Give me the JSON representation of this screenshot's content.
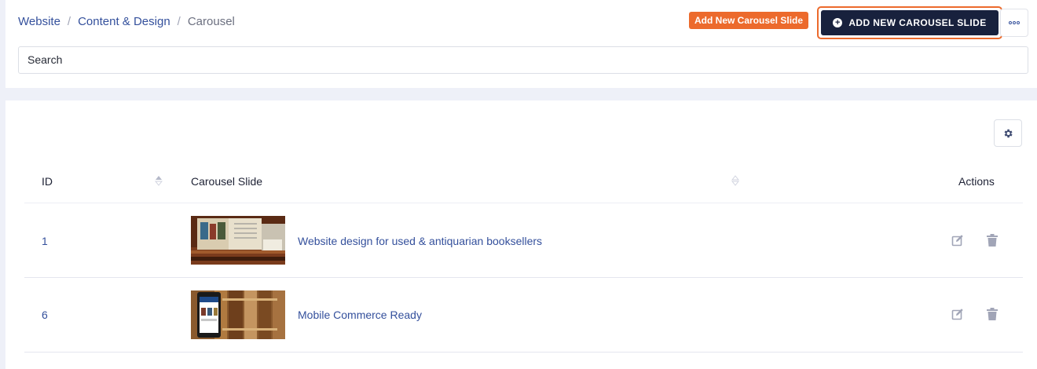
{
  "breadcrumb": {
    "items": [
      "Website",
      "Content & Design"
    ],
    "separator": "/",
    "current": "Carousel"
  },
  "header": {
    "tooltip": "Add New Carousel Slide",
    "add_button_label": "ADD NEW CAROUSEL SLIDE",
    "more_icon": "ellipsis-icon"
  },
  "search": {
    "value": "Search"
  },
  "table": {
    "columns": {
      "id": "ID",
      "slide": "Carousel Slide",
      "actions": "Actions"
    },
    "rows": [
      {
        "id": "1",
        "title": "Website design for used & antiquarian booksellers",
        "thumbnail": "antique-books-image"
      },
      {
        "id": "6",
        "title": "Mobile Commerce Ready",
        "thumbnail": "mobile-phone-books-image"
      }
    ]
  },
  "colors": {
    "accent": "#ec6a2c",
    "primary_dark": "#18213d",
    "link": "#34509c"
  }
}
